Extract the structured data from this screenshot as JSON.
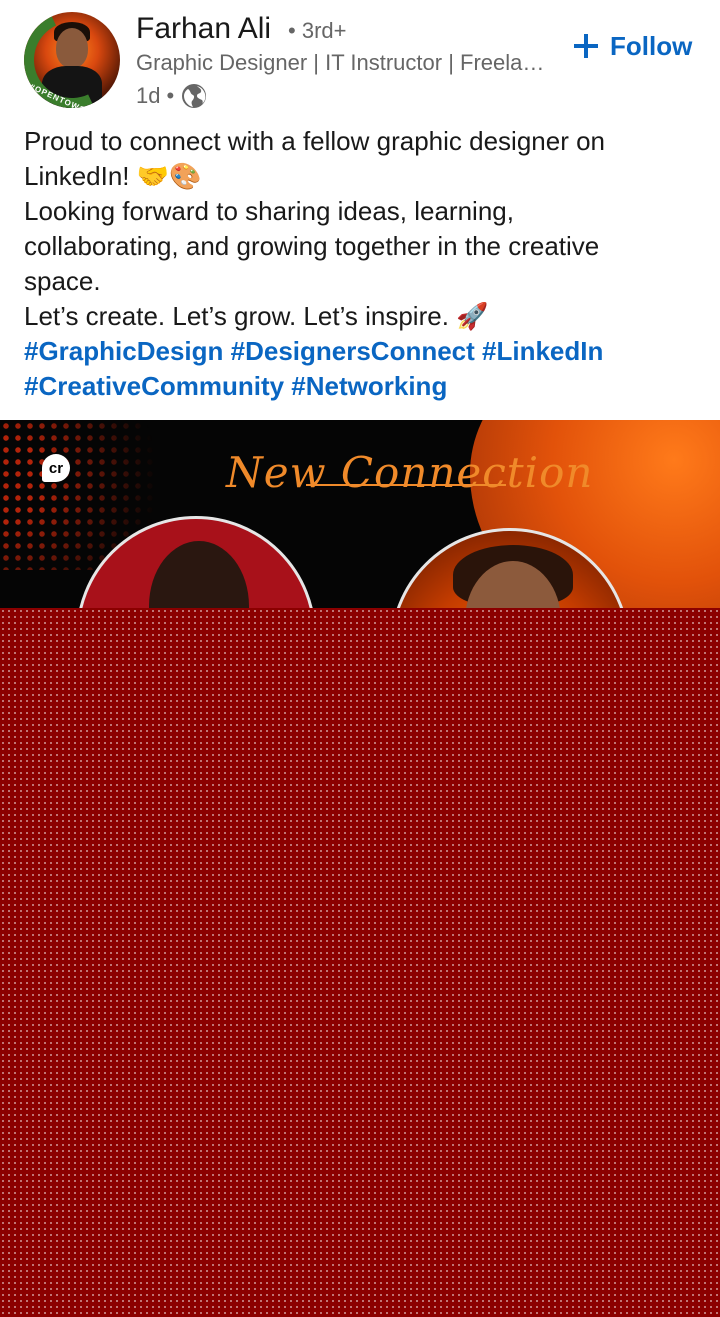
{
  "author": {
    "name": "Farhan Ali",
    "degree": "3rd+",
    "headline": "Graphic Designer | IT Instructor | Freelancer",
    "time_ago": "1d",
    "visibility_icon": "globe-icon",
    "avatar_badge_text": "#OPENTOWORK"
  },
  "actions": {
    "follow_label": "Follow",
    "follow_icon": "plus-icon"
  },
  "post": {
    "lines": [
      "Proud to connect with a fellow graphic designer on",
      "LinkedIn! 🤝🎨",
      "Looking forward to sharing ideas, learning,",
      "collaborating, and growing together in the creative",
      "space.",
      "Let’s create. Let’s grow. Let’s inspire. 🚀"
    ],
    "hashtag_lines": [
      "#GraphicDesign #DesignersConnect #LinkedIn",
      "#CreativeCommunity #Networking"
    ]
  },
  "image": {
    "logo_text": "cr",
    "title_script": "New Connection"
  },
  "colors": {
    "link_blue": "#0a66c2",
    "text_primary": "#191919",
    "text_secondary": "#666666",
    "image_accent": "#f08a2a",
    "overlay": "#8b0000"
  }
}
